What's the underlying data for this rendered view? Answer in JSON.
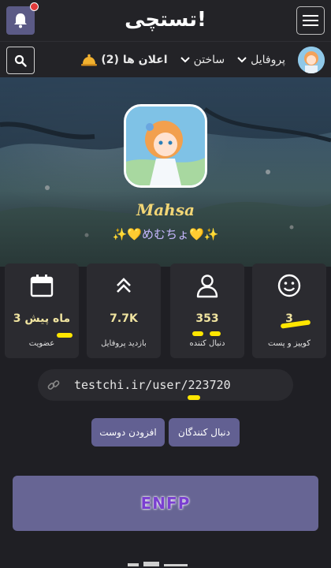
{
  "header": {
    "logo_text": "تستچی!",
    "notification_dot_color": "#e23a3a"
  },
  "nav": {
    "items": [
      {
        "label": "پروفایل"
      },
      {
        "label": "ساختن"
      },
      {
        "label": "اعلان ها (2)"
      }
    ]
  },
  "profile": {
    "username": "Mahsa",
    "tagline": "✨💛めむちょ💛✨"
  },
  "stats": [
    {
      "icon": "smiley-icon",
      "value": "3",
      "label": "کوییز و پست"
    },
    {
      "icon": "user-icon",
      "value": "353",
      "label": "دنبال کننده"
    },
    {
      "icon": "chevrons-up-icon",
      "value": "7.7K",
      "label": "بازدید پروفایل"
    },
    {
      "icon": "calendar-icon",
      "value": "3 ماه پیش",
      "label": "عضویت"
    }
  ],
  "profile_url": "testchi.ir/user/223720",
  "actions": {
    "followers_label": "دنبال کنندگان",
    "add_friend_label": "افزودن دوست"
  },
  "mbti": "ENFP",
  "colors": {
    "accent": "#626092",
    "highlight": "#ffe600",
    "username": "#f2d675"
  }
}
